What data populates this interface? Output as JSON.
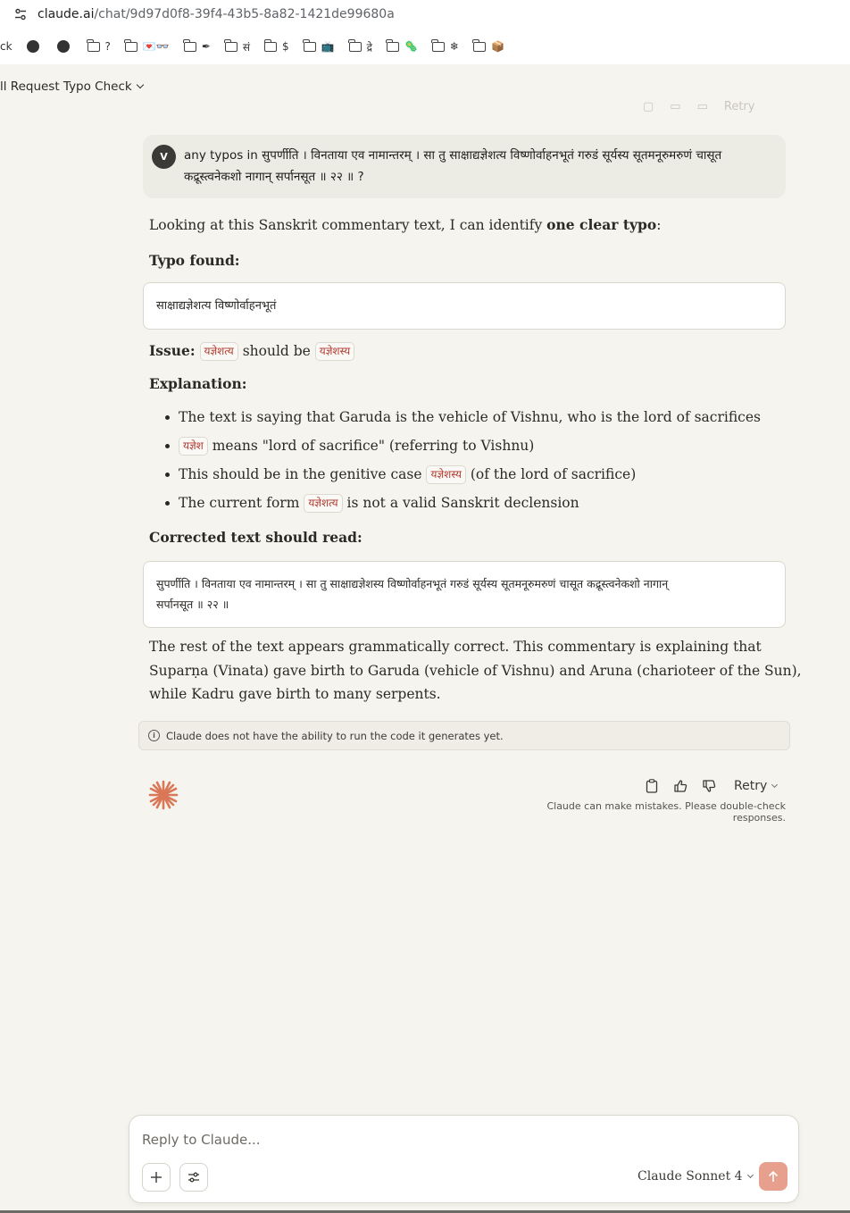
{
  "browser": {
    "url_host": "claude.ai",
    "url_path": "/chat/9d97d0f8-39f4-43b5-8a82-1421de99680a",
    "bookmarks": [
      {
        "type": "text",
        "label": "ck"
      },
      {
        "type": "globe",
        "label": ""
      },
      {
        "type": "globe",
        "label": ""
      },
      {
        "type": "folder",
        "label": "?"
      },
      {
        "type": "folder",
        "label": "💌👓"
      },
      {
        "type": "folder",
        "label": "✒"
      },
      {
        "type": "folder",
        "label": "सं"
      },
      {
        "type": "folder",
        "label": "$"
      },
      {
        "type": "folder",
        "label": "📺"
      },
      {
        "type": "folder",
        "label": "द्रे"
      },
      {
        "type": "folder",
        "label": "🦠"
      },
      {
        "type": "folder",
        "label": "❄"
      },
      {
        "type": "folder",
        "label": "📦"
      }
    ]
  },
  "chat": {
    "title": "ll Request Typo Check",
    "ghost_retry": "Retry"
  },
  "user_message": {
    "avatar": "V",
    "line1": "any typos in सुपर्णीति । विनताया एव नामान्तरम् । सा तु साक्षाद्यज्ञेशत्य विष्णोर्वाहनभूतं गरुडं सूर्यस्य सूतमनूरुमरुणं चासूत",
    "line2": "कद्रूस्त्वनेकशो नागान् सर्पानसूत ॥ २२ ॥ ?"
  },
  "response": {
    "intro_prefix": "Looking at this Sanskrit commentary text, I can identify ",
    "intro_bold": "one clear typo",
    "intro_suffix": ":",
    "typo_heading": "Typo found:",
    "typo_code": "साक्षाद्यज्ञेशत्य विष्णोर्वाहनभूतं",
    "issue_label": "Issue:",
    "issue_wrong": "यज्ञेशत्य",
    "issue_mid": " should be ",
    "issue_right": "यज्ञेशस्य",
    "explanation_heading": "Explanation:",
    "bullet1": "The text is saying that Garuda is the vehicle of Vishnu, who is the lord of sacrifices",
    "bullet2_code": "यज्ञेश",
    "bullet2_text": " means \"lord of sacrifice\" (referring to Vishnu)",
    "bullet3_prefix": "This should be in the genitive case ",
    "bullet3_code": "यज्ञेशस्य",
    "bullet3_suffix": " (of the lord of sacrifice)",
    "bullet4_prefix": "The current form ",
    "bullet4_code": "यज्ञेशत्य",
    "bullet4_suffix": " is not a valid Sanskrit declension",
    "corrected_heading": "Corrected text should read:",
    "corrected_line1": "सुपर्णीति । विनताया एव नामान्तरम् । सा तु साक्षाद्यज्ञेशस्य विष्णोर्वाहनभूतं गरुडं सूर्यस्य सूतमनूरुमरुणं चासूत कद्रूस्त्वनेकशो नागान्",
    "corrected_line2": "सर्पानसूत ॥ २२ ॥",
    "closing_line1": "The rest of the text appears grammatically correct. This commentary is explaining that",
    "closing_line2": "Suparṇa (Vinata) gave birth to Garuda (vehicle of Vishnu) and Aruna (charioteer of the Sun),",
    "closing_line3": "while Kadru gave birth to many serpents."
  },
  "notice": "Claude does not have the ability to run the code it generates yet.",
  "actions": {
    "retry_label": "Retry",
    "disclaimer": "Claude can make mistakes. Please double-check responses."
  },
  "composer": {
    "placeholder": "Reply to Claude...",
    "model": "Claude Sonnet 4"
  },
  "colors": {
    "accent": "#d97757",
    "send_button": "#e8a08e",
    "code_text": "#b13b31",
    "page_bg": "#f5f4ef"
  }
}
